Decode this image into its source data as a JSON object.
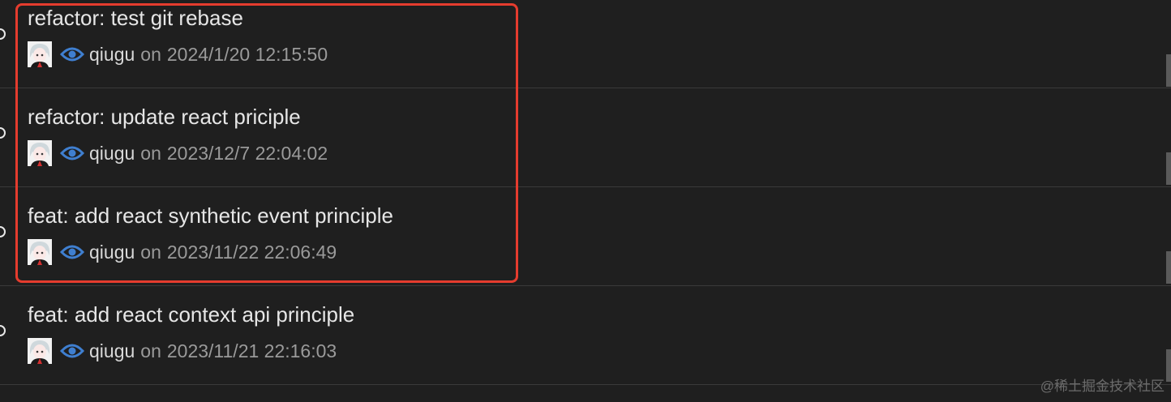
{
  "commits": [
    {
      "message": "refactor: test git rebase",
      "author": "qiugu",
      "on": "on",
      "date": "2024/1/20 12:15:50"
    },
    {
      "message": "refactor: update react priciple",
      "author": "qiugu",
      "on": "on",
      "date": "2023/12/7 22:04:02"
    },
    {
      "message": "feat: add react synthetic event principle",
      "author": "qiugu",
      "on": "on",
      "date": "2023/11/22 22:06:49"
    },
    {
      "message": "feat: add react context api principle",
      "author": "qiugu",
      "on": "on",
      "date": "2023/11/21 22:16:03"
    }
  ],
  "icons": {
    "avatar": "user-avatar",
    "eye": "eye-icon",
    "graph": "commit-graph-node"
  },
  "colors": {
    "background": "#1f1f1f",
    "highlight": "#e53c2e",
    "eye": "#3f7fd0"
  },
  "watermark": "@稀土掘金技术社区"
}
